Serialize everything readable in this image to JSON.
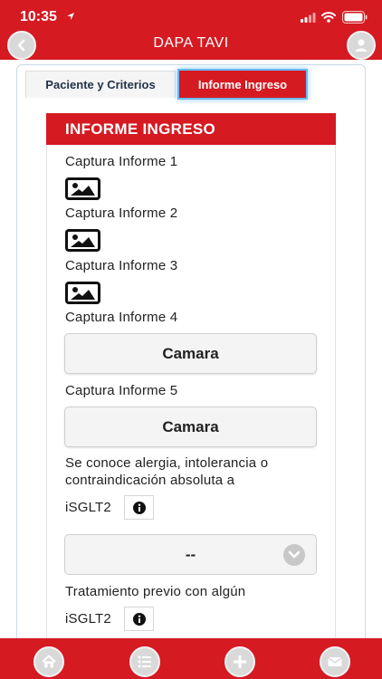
{
  "status_bar": {
    "time": "10:35"
  },
  "nav": {
    "title": "DAPA TAVI"
  },
  "tabs": [
    {
      "label": "Paciente y Criterios"
    },
    {
      "label": "Informe Ingreso"
    }
  ],
  "form": {
    "header": "INFORME INGRESO",
    "capture_labels": [
      "Captura Informe 1",
      "Captura Informe 2",
      "Captura Informe 3",
      "Captura Informe 4",
      "Captura Informe 5"
    ],
    "camara_label": "Camara",
    "allergy_question_line1": "Se conoce alergia, intolerancia o",
    "allergy_question_line2": "contraindicación absoluta a",
    "allergy_question_line3": "iSGLT2",
    "select_value": "--",
    "prior_treatment_line1": "Tratamiento previo con algún",
    "prior_treatment_line2": "iSGLT2"
  },
  "colors": {
    "brand_red": "#d51a22",
    "tab_glow": "#6cb8f3"
  },
  "icons": [
    "back-arrow-icon",
    "profile-icon",
    "image-icon",
    "info-icon",
    "chevron-down-icon",
    "home-icon",
    "list-icon",
    "add-icon",
    "mail-icon"
  ]
}
